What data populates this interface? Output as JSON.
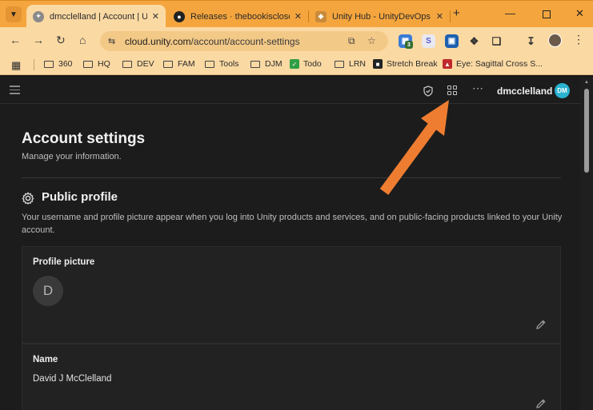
{
  "browser": {
    "tabs": [
      {
        "title": "dmcclelland | Account | Unit",
        "active": true,
        "favicon": "unity-cloud-icon"
      },
      {
        "title": "Releases · thebookisclosed/\\",
        "active": false,
        "favicon": "github-icon"
      },
      {
        "title": "Unity Hub - UnityDevOps",
        "active": false,
        "favicon": "unity-hub-icon"
      }
    ],
    "url_host": "cloud.unity.com",
    "url_path": "/account/account-settings",
    "extension_badge": "3",
    "bookmarks": [
      {
        "label": "360",
        "icon": "folder"
      },
      {
        "label": "HQ",
        "icon": "folder"
      },
      {
        "label": "DEV",
        "icon": "folder"
      },
      {
        "label": "FAM",
        "icon": "folder"
      },
      {
        "label": "Tools",
        "icon": "folder"
      },
      {
        "label": "DJM",
        "icon": "folder"
      },
      {
        "label": "Todo",
        "icon": "todo-icon"
      },
      {
        "label": "LRN",
        "icon": "folder"
      },
      {
        "label": "Stretch Break",
        "icon": "stretch-icon"
      },
      {
        "label": "Eye: Sagittal Cross S...",
        "icon": "eye-icon"
      }
    ]
  },
  "app": {
    "username": "dmcclelland",
    "avatar_initials": "DM",
    "avatar_color": "#2ab2d1"
  },
  "page": {
    "title": "Account settings",
    "subtitle": "Manage your information.",
    "section_title": "Public profile",
    "section_desc": "Your username and profile picture appear when you log into Unity products and services, and on public-facing products linked to your Unity account.",
    "profile_picture_label": "Profile picture",
    "profile_initial": "D",
    "name_label": "Name",
    "name_value": "David J McClelland"
  },
  "colors": {
    "browser_accent": "#f5a53d",
    "annotation_arrow": "#ee7d32"
  }
}
